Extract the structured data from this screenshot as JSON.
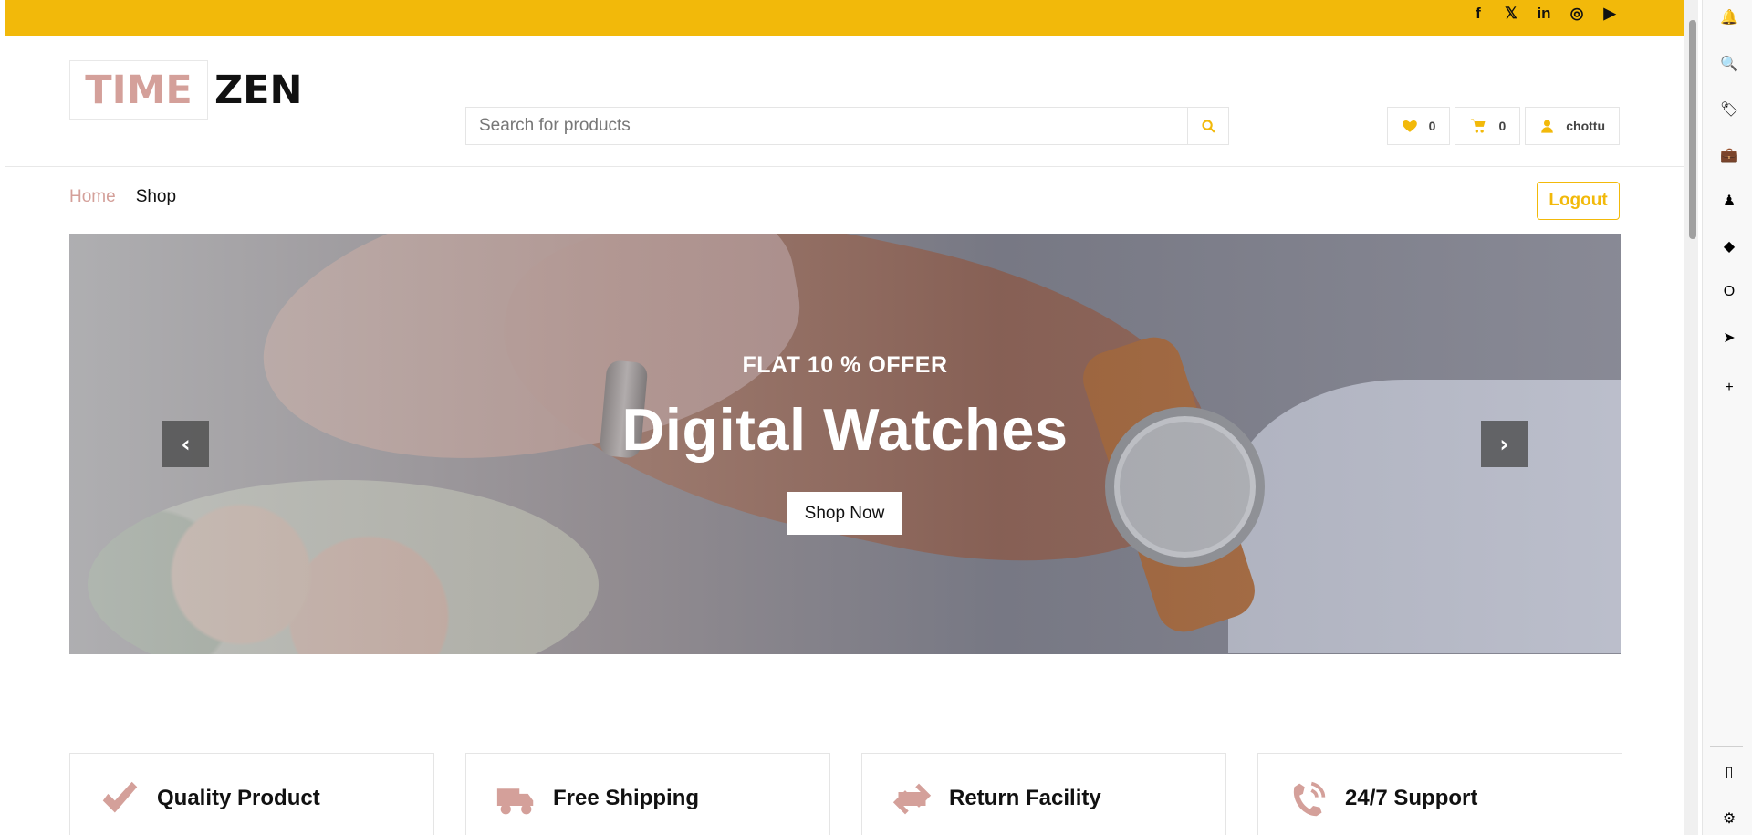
{
  "top_bar": {
    "social": [
      "f",
      "𝕏",
      "in",
      "◎",
      "▶"
    ]
  },
  "header": {
    "logo": {
      "part1": "TIME",
      "part2": "ZEN"
    },
    "search": {
      "placeholder": "Search for products"
    },
    "wishlist_count": "0",
    "cart_count": "0",
    "user": "chottu"
  },
  "nav": {
    "items": [
      "Home",
      "Shop"
    ],
    "logout": "Logout"
  },
  "hero": {
    "offer": "FLAT 10 % OFFER",
    "title": "Digital Watches",
    "button": "Shop Now"
  },
  "features": [
    {
      "label": "Quality Product",
      "icon": "check-icon"
    },
    {
      "label": "Free Shipping",
      "icon": "truck-icon"
    },
    {
      "label": "Return Facility",
      "icon": "exchange-icon"
    },
    {
      "label": "24/7 Support",
      "icon": "phone-icon"
    }
  ],
  "colors": {
    "accent": "#F2B90A",
    "brand": "#D4A09A"
  }
}
